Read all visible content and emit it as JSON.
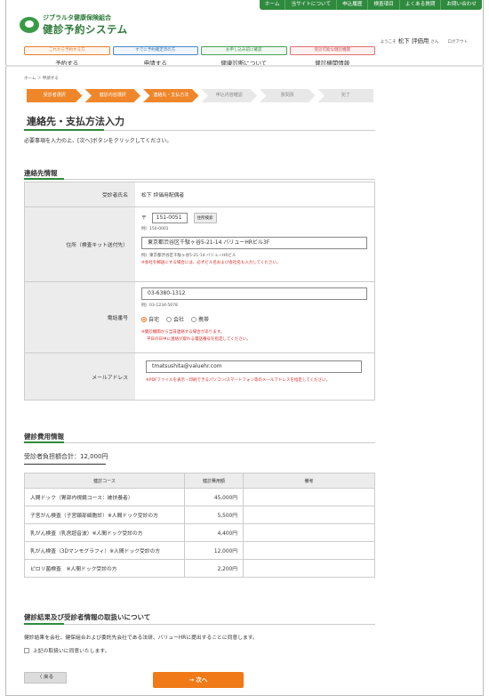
{
  "topnav": [
    "ホーム",
    "当サイトについて",
    "申込履歴",
    "検査項目",
    "よくある質問",
    "お問い合わせ"
  ],
  "logo": {
    "sub": "ジブラルタ健康保険組合",
    "main": "健診予約システム"
  },
  "user": {
    "greeting": "ようこそ",
    "name": "松下 評価用",
    "honorific": "さん",
    "logout": "ログアウト"
  },
  "gnav": [
    {
      "top": "これから予約する方",
      "label": "予約する"
    },
    {
      "top": "すでに予約確定済の方",
      "label": "申請する"
    },
    {
      "top": "お申し込み前に確認",
      "label": "健康診断について"
    },
    {
      "top": "受診可能な健診機関",
      "label": "健診機関情報"
    }
  ],
  "breadcrumb": "ホーム ＞ 申請する",
  "steps": [
    {
      "label": "受診者選択",
      "state": "done"
    },
    {
      "label": "健診内容選択",
      "state": "done"
    },
    {
      "label": "連絡先・支払方法",
      "state": "done"
    },
    {
      "label": "申込内容確認",
      "state": "todo"
    },
    {
      "label": "質問票",
      "state": "todo"
    },
    {
      "label": "完了",
      "state": "todo"
    }
  ],
  "page_title": "連絡先・支払方法入力",
  "intro": "必要事項を入力の上、[次へ]ボタンをクリックしてください。",
  "contact": {
    "heading": "連絡先情報",
    "name_label": "受診者氏名",
    "name_value": "松下 評価用配偶者",
    "address_label": "住所（検査キット送付先）",
    "zip_mark": "〒",
    "zip_value": "151-0051",
    "zip_button": "住所検索",
    "zip_example": "例）150-0001",
    "address_value": "東京都渋谷区千駄ヶ谷5-21-14 バリューHRビル3F",
    "address_example": "例）東京都渋谷区千駄ヶ谷5-21-14 バリューHRビル",
    "address_note": "※会社を郵送にする場合には、必ずビル名および会社名も入力してください。",
    "phone_label": "電話番号",
    "phone_value": "03-6380-1312",
    "phone_example": "例）03-1234-5678",
    "phone_options": [
      "自宅",
      "会社",
      "携帯"
    ],
    "phone_selected": "自宅",
    "phone_note1": "※健診機関から当日連絡する場合があります。",
    "phone_note2": "平日の日中に連絡が取れる電話番号を指定してください。",
    "email_label": "メールアドレス",
    "email_value": "tmatsushita@valuehr.com",
    "email_note": "※PDFファイルを表示・印刷できるパソコン/スマートフォン等のメールアドレスを指定してください。"
  },
  "cost": {
    "heading": "健診費用情報",
    "total": "受診者負担額合計：12,000円",
    "headers": [
      "健診コース",
      "健診費用額",
      "備考"
    ],
    "rows": [
      {
        "course": "人間ドック（胃部内視鏡コース：被扶養者）",
        "amount": "45,000円",
        "note": ""
      },
      {
        "course": "子宮がん検査（子宮頸部細胞診）※人間ドック受診の方",
        "amount": "5,500円",
        "note": ""
      },
      {
        "course": "乳がん検査（乳房超音波）※人間ドック受診の方",
        "amount": "4,400円",
        "note": ""
      },
      {
        "course": "乳がん検査（3Dマンモグラフィ）※人間ドック受診の方",
        "amount": "12,000円",
        "note": ""
      },
      {
        "course": "ピロリ菌検査　※人間ドック受診の方",
        "amount": "2,200円",
        "note": ""
      }
    ]
  },
  "agreement": {
    "heading": "健診結果及び受診者情報の取扱いについて",
    "text": "健診結果を会社、健保組合および委託先会社である法研、バリューHRに提出することに同意します。",
    "checkbox": "上記の取扱いに同意いたします。"
  },
  "buttons": {
    "back": "〈 戻る",
    "next": "→ 次へ"
  }
}
